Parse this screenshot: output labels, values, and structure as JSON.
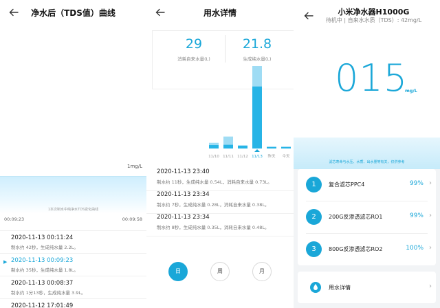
{
  "panel1": {
    "title": "净水后（TDS值）曲线",
    "unit": "1mg/L",
    "note": "1本次制水中纯净水TDS变化曲线",
    "time_start": "00:09:23",
    "time_end": "00:09:58",
    "records": [
      {
        "time": "2020-11-13 00:11:24",
        "detail": "制水约 42秒，生成纯水量 2.2L。",
        "active": false
      },
      {
        "time": "2020-11-13 00:09:23",
        "detail": "制水约 35秒，生成纯水量 1.8L。",
        "active": true
      },
      {
        "time": "2020-11-13 00:08:37",
        "detail": "制水约 1分13秒，生成纯水量 3.9L。",
        "active": false
      },
      {
        "time": "2020-11-12 17:01:49",
        "detail": "",
        "active": false
      }
    ]
  },
  "panel2": {
    "title": "用水详情",
    "stats": [
      {
        "value": "29",
        "label": "消耗自来水量(L)"
      },
      {
        "value": "21.8",
        "label": "生成纯水量(L)"
      }
    ],
    "records": [
      {
        "time": "2020-11-13 23:40",
        "detail": "制水约 11秒，生成纯水量 0.54L，消耗自来水量 0.73L。"
      },
      {
        "time": "2020-11-13 23:34",
        "detail": "制水约 7秒，生成纯水量 0.28L，消耗自来水量 0.38L。"
      },
      {
        "time": "2020-11-13 23:34",
        "detail": "制水约 8秒，生成纯水量 0.35L，消耗自来水量 0.48L。"
      }
    ],
    "period_buttons": [
      {
        "label": "日",
        "selected": true
      },
      {
        "label": "周",
        "selected": false
      },
      {
        "label": "月",
        "selected": false
      }
    ]
  },
  "chart_data": {
    "type": "bar",
    "categories": [
      "11/10",
      "11/11",
      "11/12",
      "11/13",
      "昨天",
      "今天"
    ],
    "series": [
      {
        "values": [
          1.2,
          1.3,
          1.0,
          21.8,
          0.5,
          0.5
        ]
      },
      {
        "values": [
          2.0,
          4.2,
          1.1,
          29,
          0.7,
          0.7
        ]
      }
    ],
    "selected_category": "11/13",
    "colors": {
      "pure": "#27b4e6",
      "tap": "#9fdcf4"
    }
  },
  "panel3": {
    "title": "小米净水器H1000G",
    "subtitle": "待机中 | 自来水水质（TDS）: 42mg/L",
    "tds_value": "015",
    "tds_unit": "mg/L",
    "note": "滤芯寿命与水压、水质、出水量等有关，仅供参考",
    "filters": [
      {
        "index": "1",
        "name": "复合滤芯PPC4",
        "percent": "99%"
      },
      {
        "index": "2",
        "name": "200G反渗透滤芯RO1",
        "percent": "99%"
      },
      {
        "index": "3",
        "name": "800G反渗透滤芯RO2",
        "percent": "100%"
      }
    ],
    "usage_label": "用水详情"
  },
  "colors": {
    "accent": "#1aa7d8"
  }
}
